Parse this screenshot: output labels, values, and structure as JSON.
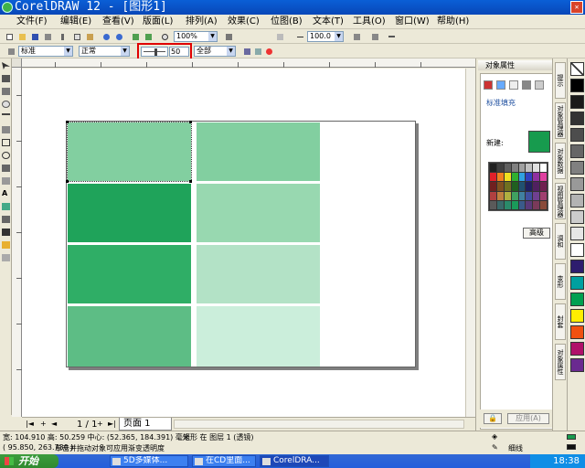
{
  "window": {
    "title": "CorelDRAW 12 - [图形1]",
    "close_label": "关闭"
  },
  "menu": [
    "文件(F)",
    "编辑(E)",
    "查看(V)",
    "版面(L)",
    "排列(A)",
    "效果(C)",
    "位图(B)",
    "文本(T)",
    "工具(O)",
    "窗口(W)",
    "帮助(H)"
  ],
  "toolbar1": {
    "zoom": "100%",
    "outline_width": "100.0"
  },
  "toolbar2": {
    "transparency_type": "标准",
    "merge_mode": "正常",
    "start_value": "50",
    "target": "全部"
  },
  "pages": {
    "counter": "1 / 1",
    "tab_label": "页面 1"
  },
  "status": {
    "size": "宽: 104.910  高: 50.259  中心: (52.365, 184.391)  毫米",
    "object": "矩形 在 图层 1 (透镜)",
    "cursor": "( 95.850, 263.730 )",
    "hint": "单击并拖动对象可应用渐变透明度",
    "fill_name": "",
    "outline_name": "细线",
    "fill_color": "#179b4e",
    "outline_color": "#111111"
  },
  "docker": {
    "title": "对象属性",
    "section": "标准填充",
    "new_label": "新建:",
    "new_color": "#179b4e",
    "advanced": "高级",
    "apply": "应用(A)",
    "palette_colors": [
      "#202020",
      "#404040",
      "#606060",
      "#808080",
      "#a0a0a0",
      "#c0c0c0",
      "#e0e0e0",
      "#ffffff",
      "#e0202a",
      "#f08020",
      "#f0e020",
      "#30b030",
      "#30a0e0",
      "#3040c0",
      "#9030a0",
      "#e040a0",
      "#702020",
      "#805020",
      "#707020",
      "#206020",
      "#205070",
      "#202060",
      "#502060",
      "#702050",
      "#b04040",
      "#c08040",
      "#b0b040",
      "#40a060",
      "#4080a0",
      "#4050a0",
      "#704090",
      "#a04070",
      "#5a5a5a",
      "#3a6a6a",
      "#2a8a6a",
      "#1a9a5a",
      "#3a5a8a",
      "#5a3a7a",
      "#7a3a5a",
      "#8a4a3a"
    ]
  },
  "sidetabs": [
    "提示",
    "对象管理器",
    "对象数据",
    "视图管理器",
    "调和",
    "变形",
    "封套",
    "对象属性"
  ],
  "right_palette": [
    "#000000",
    "#1a1a1a",
    "#333333",
    "#4d4d4d",
    "#666666",
    "#808080",
    "#999999",
    "#b3b3b3",
    "#cccccc",
    "#e6e6e6",
    "#ffffff",
    "#2d1d6e",
    "#00a0a0",
    "#00a050",
    "#ffee00",
    "#f05010",
    "#b0106a",
    "#6a2a90"
  ],
  "canvas": {
    "page_fill": "#ffffff",
    "left_column": [
      "#82cfa0",
      "#1fa35a",
      "#2fae66",
      "#5dbd85"
    ],
    "right_column": [
      "#82cfa0",
      "#98d8b0",
      "#b3e2c6",
      "#cbeedb"
    ]
  },
  "taskbar": {
    "start": "开始",
    "tasks": [
      "5D多媒体...",
      "在CD里面...",
      "CorelDRA..."
    ],
    "clock": "18:38"
  }
}
